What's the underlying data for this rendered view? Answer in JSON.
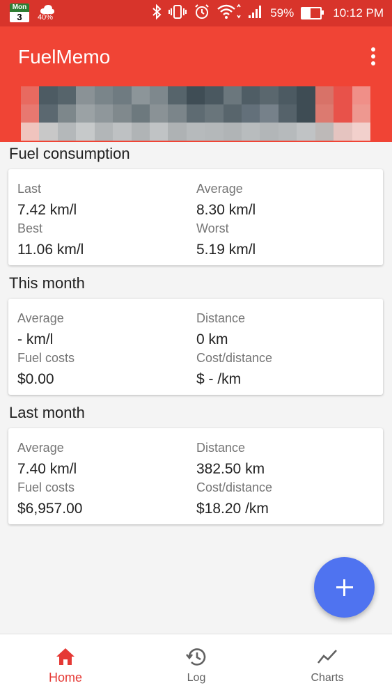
{
  "status_bar": {
    "calendar_day_name": "Mon",
    "calendar_day_num": "3",
    "weather_temp": "40%",
    "battery": "59%",
    "time": "10:12 PM"
  },
  "app_bar": {
    "title": "FuelMemo"
  },
  "fuel_consumption": {
    "title": "Fuel consumption",
    "last_label": "Last",
    "last_value": "7.42 km/l",
    "average_label": "Average",
    "average_value": "8.30 km/l",
    "best_label": "Best",
    "best_value": "11.06 km/l",
    "worst_label": "Worst",
    "worst_value": "5.19 km/l"
  },
  "this_month": {
    "title": "This month",
    "average_label": "Average",
    "average_value": "- km/l",
    "distance_label": "Distance",
    "distance_value": "0 km",
    "fuel_costs_label": "Fuel costs",
    "fuel_costs_value": "$0.00",
    "cost_distance_label": "Cost/distance",
    "cost_distance_value": "$ - /km"
  },
  "last_month": {
    "title": "Last month",
    "average_label": "Average",
    "average_value": "7.40 km/l",
    "distance_label": "Distance",
    "distance_value": "382.50 km",
    "fuel_costs_label": "Fuel costs",
    "fuel_costs_value": "$6,957.00",
    "cost_distance_label": "Cost/distance",
    "cost_distance_value": "$18.20 /km"
  },
  "bottom_nav": {
    "home": "Home",
    "log": "Log",
    "charts": "Charts"
  },
  "colors": {
    "status_bar": "#d8342b",
    "app_bar": "#f04435",
    "accent_fab": "#4f73f0",
    "active_nav": "#e53935"
  },
  "icons": {
    "fab": "plus-icon",
    "home": "home-icon",
    "log": "history-icon",
    "charts": "trending-icon",
    "menu": "more-vert-icon"
  }
}
